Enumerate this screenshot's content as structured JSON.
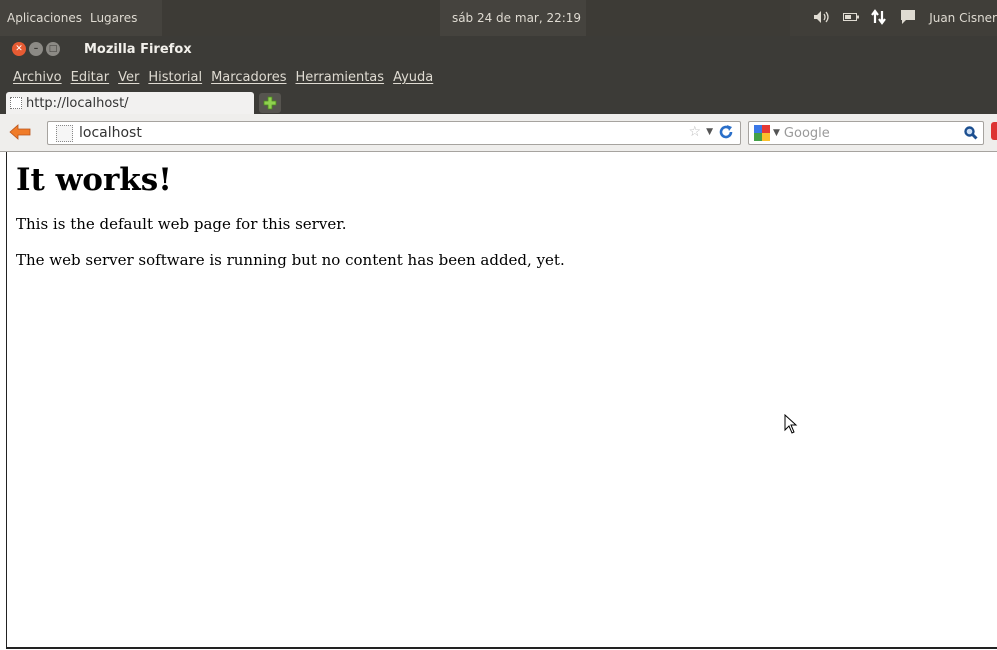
{
  "panel": {
    "applications": "Aplicaciones",
    "places": "Lugares",
    "clock": "sáb 24 de mar, 22:19",
    "user": "Juan Cisner"
  },
  "window": {
    "title": "Mozilla Firefox"
  },
  "menu": [
    "Archivo",
    "Editar",
    "Ver",
    "Historial",
    "Marcadores",
    "Herramientas",
    "Ayuda"
  ],
  "tab": {
    "label": "http://localhost/"
  },
  "nav": {
    "url": "localhost",
    "search_placeholder": "Google"
  },
  "page": {
    "heading": "It works!",
    "paragraph1": "This is the default web page for this server.",
    "paragraph2": "The web server software is running but no content has been added, yet."
  },
  "icons": {
    "volume": "volume-icon",
    "battery": "battery-icon",
    "network": "network-icon",
    "messages": "messages-icon",
    "back": "back-arrow-icon",
    "bookmark": "star-icon",
    "reload": "reload-icon",
    "search": "magnifier-icon",
    "new_tab": "plus-icon"
  },
  "colors": {
    "panel_bg": "#3d3b36",
    "window_chrome": "#3c3b37",
    "close_button": "#e65b33",
    "back_arrow": "#f07c2a"
  }
}
